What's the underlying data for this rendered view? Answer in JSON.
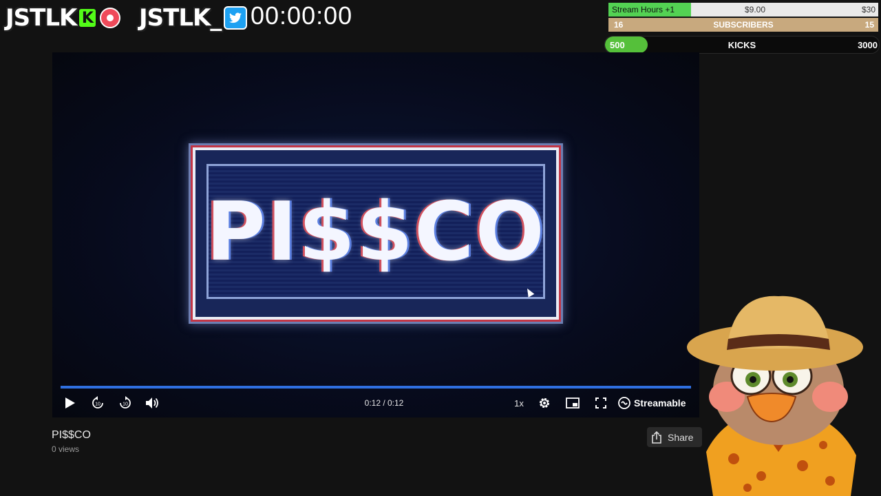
{
  "overlay": {
    "brand_kick": "JSTLK",
    "kick_letter": "K",
    "brand_twitter": "JSTLK_",
    "timer": "00:00:00"
  },
  "goals": {
    "hours": {
      "label": "Stream Hours +1",
      "mid": "$9.00",
      "max": "$30"
    },
    "subs": {
      "current": "16",
      "label": "SUBSCRIBERS",
      "max": "15"
    },
    "kicks": {
      "current": "500",
      "label": "KICKS",
      "max": "3000"
    }
  },
  "player": {
    "video_title_text": "PI$$CO",
    "progress": 1.0,
    "time": "0:12 / 0:12",
    "speed": "1x",
    "brand": "Streamable"
  },
  "video": {
    "title": "PI$$CO",
    "views": "0 views",
    "share_label": "Share"
  },
  "colors": {
    "accent_blue": "#2f6fe0",
    "kick_green": "#53fc18",
    "subs_tan": "#c8a97e"
  }
}
